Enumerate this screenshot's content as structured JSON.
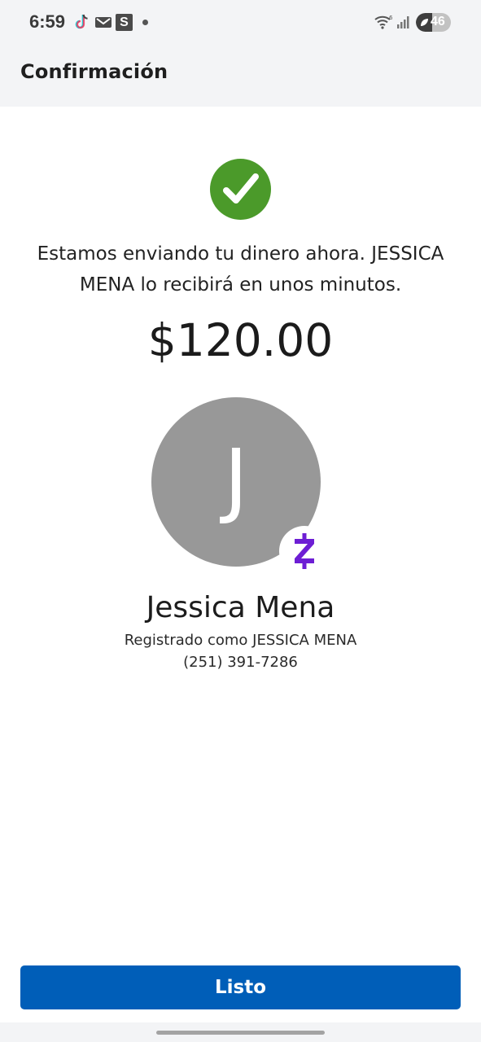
{
  "status_bar": {
    "time": "6:59",
    "icons": [
      "tiktok-icon",
      "mail-icon",
      "s-app-icon",
      "dot-icon",
      "wifi-icon",
      "signal-icon",
      "battery-icon"
    ],
    "s_app_letter": "S",
    "wifi_badge": "6",
    "battery_level": "46"
  },
  "header": {
    "title": "Confirmación"
  },
  "confirmation": {
    "icon": "check-circle-icon",
    "message": "Estamos enviando tu dinero ahora. JESSICA MENA lo recibirá en unos minutos.",
    "amount": "$120.00"
  },
  "recipient": {
    "initial": "J",
    "badge_icon": "zelle-icon",
    "name": "Jessica Mena",
    "registered_as": "Registrado como JESSICA MENA",
    "phone": "(251) 391-7286"
  },
  "actions": {
    "done_label": "Listo"
  },
  "colors": {
    "accent": "#005eb8",
    "success": "#4b9a2a",
    "zelle": "#6d1ed4",
    "avatar_bg": "#989898",
    "header_bg": "#f3f4f6"
  }
}
